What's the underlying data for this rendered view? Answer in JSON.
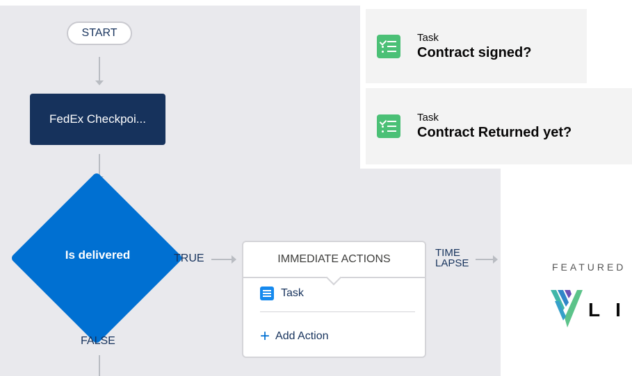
{
  "flow": {
    "start_label": "START",
    "checkpoint_label": "FedEx Checkpoi...",
    "decision_label": "Is delivered",
    "true_label": "TRUE",
    "false_label": "FALSE",
    "time_lapse_line1": "TIME",
    "time_lapse_line2": "LAPSE"
  },
  "immediate_actions": {
    "header": "IMMEDIATE ACTIONS",
    "items": [
      {
        "icon": "task-icon",
        "label": "Task"
      }
    ],
    "add_action_label": "Add Action"
  },
  "task_cards": [
    {
      "type": "Task",
      "title": "Contract signed?"
    },
    {
      "type": "Task",
      "title": "Contract Returned yet?"
    }
  ],
  "branding": {
    "featured_label": "FEATURED",
    "logo_letters": "LI"
  },
  "colors": {
    "canvas": "#e9e9ed",
    "navy": "#16325c",
    "blue": "#0070d2",
    "task_green": "#4bc076",
    "task_blue": "#1589ee"
  }
}
